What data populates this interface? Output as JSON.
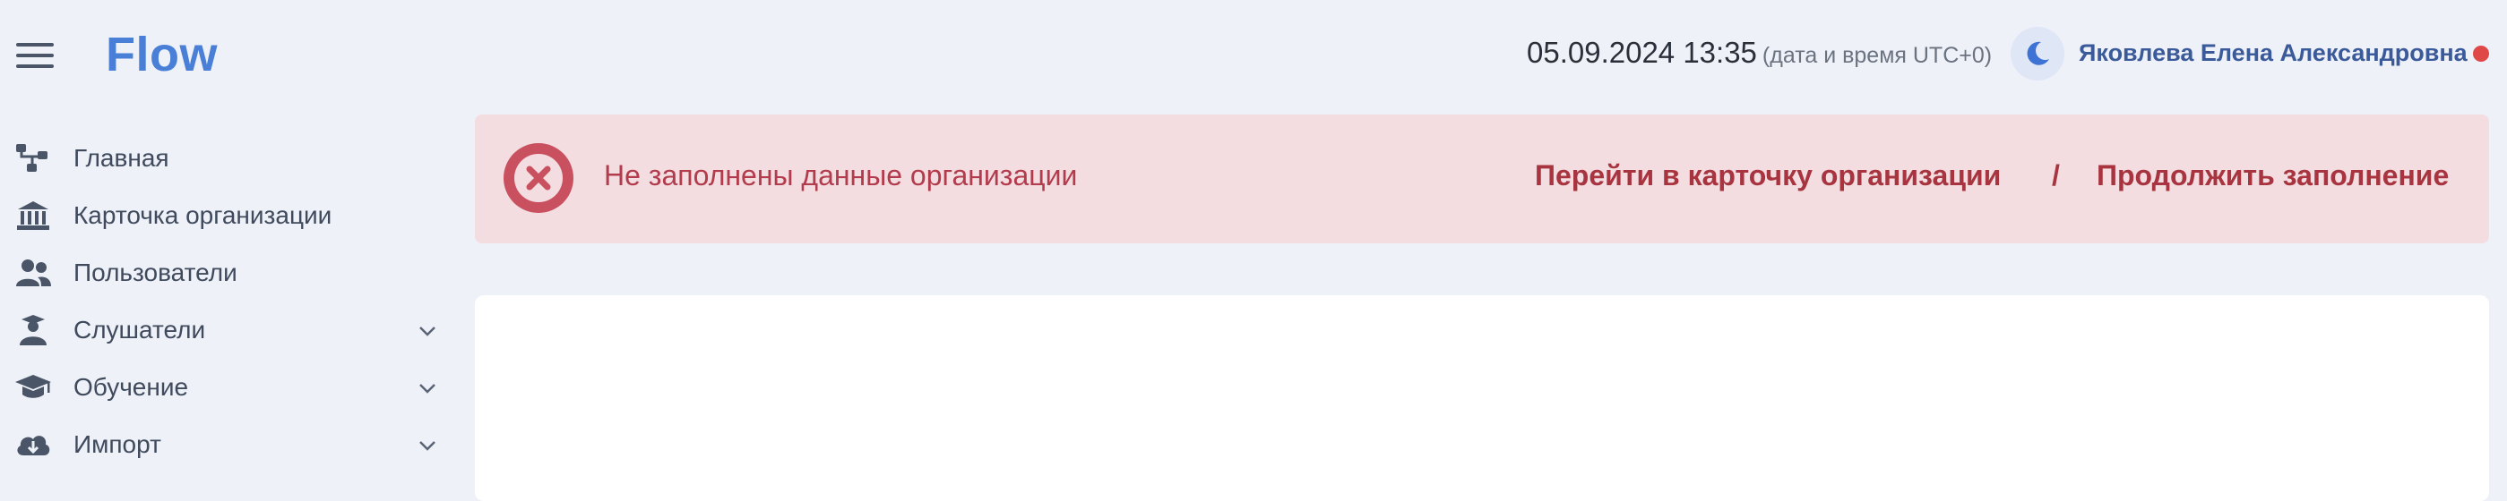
{
  "header": {
    "brand": "Flow",
    "datetime": "05.09.2024 13:35",
    "timezone_note": "(дата и время UTC+0)",
    "user_name": "Яковлева Елена Александровна",
    "menu_icon": "hamburger-icon",
    "theme_icon": "moon-icon",
    "status_color": "#e04848"
  },
  "sidebar": {
    "items": [
      {
        "label": "Главная",
        "icon": "sitemap-icon",
        "expandable": false
      },
      {
        "label": "Карточка организации",
        "icon": "bank-icon",
        "expandable": false
      },
      {
        "label": "Пользователи",
        "icon": "users-icon",
        "expandable": false
      },
      {
        "label": "Слушатели",
        "icon": "graduate-user-icon",
        "expandable": true
      },
      {
        "label": "Обучение",
        "icon": "graduation-cap-icon",
        "expandable": true
      },
      {
        "label": "Импорт",
        "icon": "cloud-download-icon",
        "expandable": true
      }
    ]
  },
  "alert": {
    "message": "Не заполнены данные организации",
    "link_card": "Перейти в карточку организации",
    "separator": "/",
    "link_continue": "Продолжить заполнение",
    "icon": "error-circle-x-icon",
    "color": "#c9505f"
  }
}
